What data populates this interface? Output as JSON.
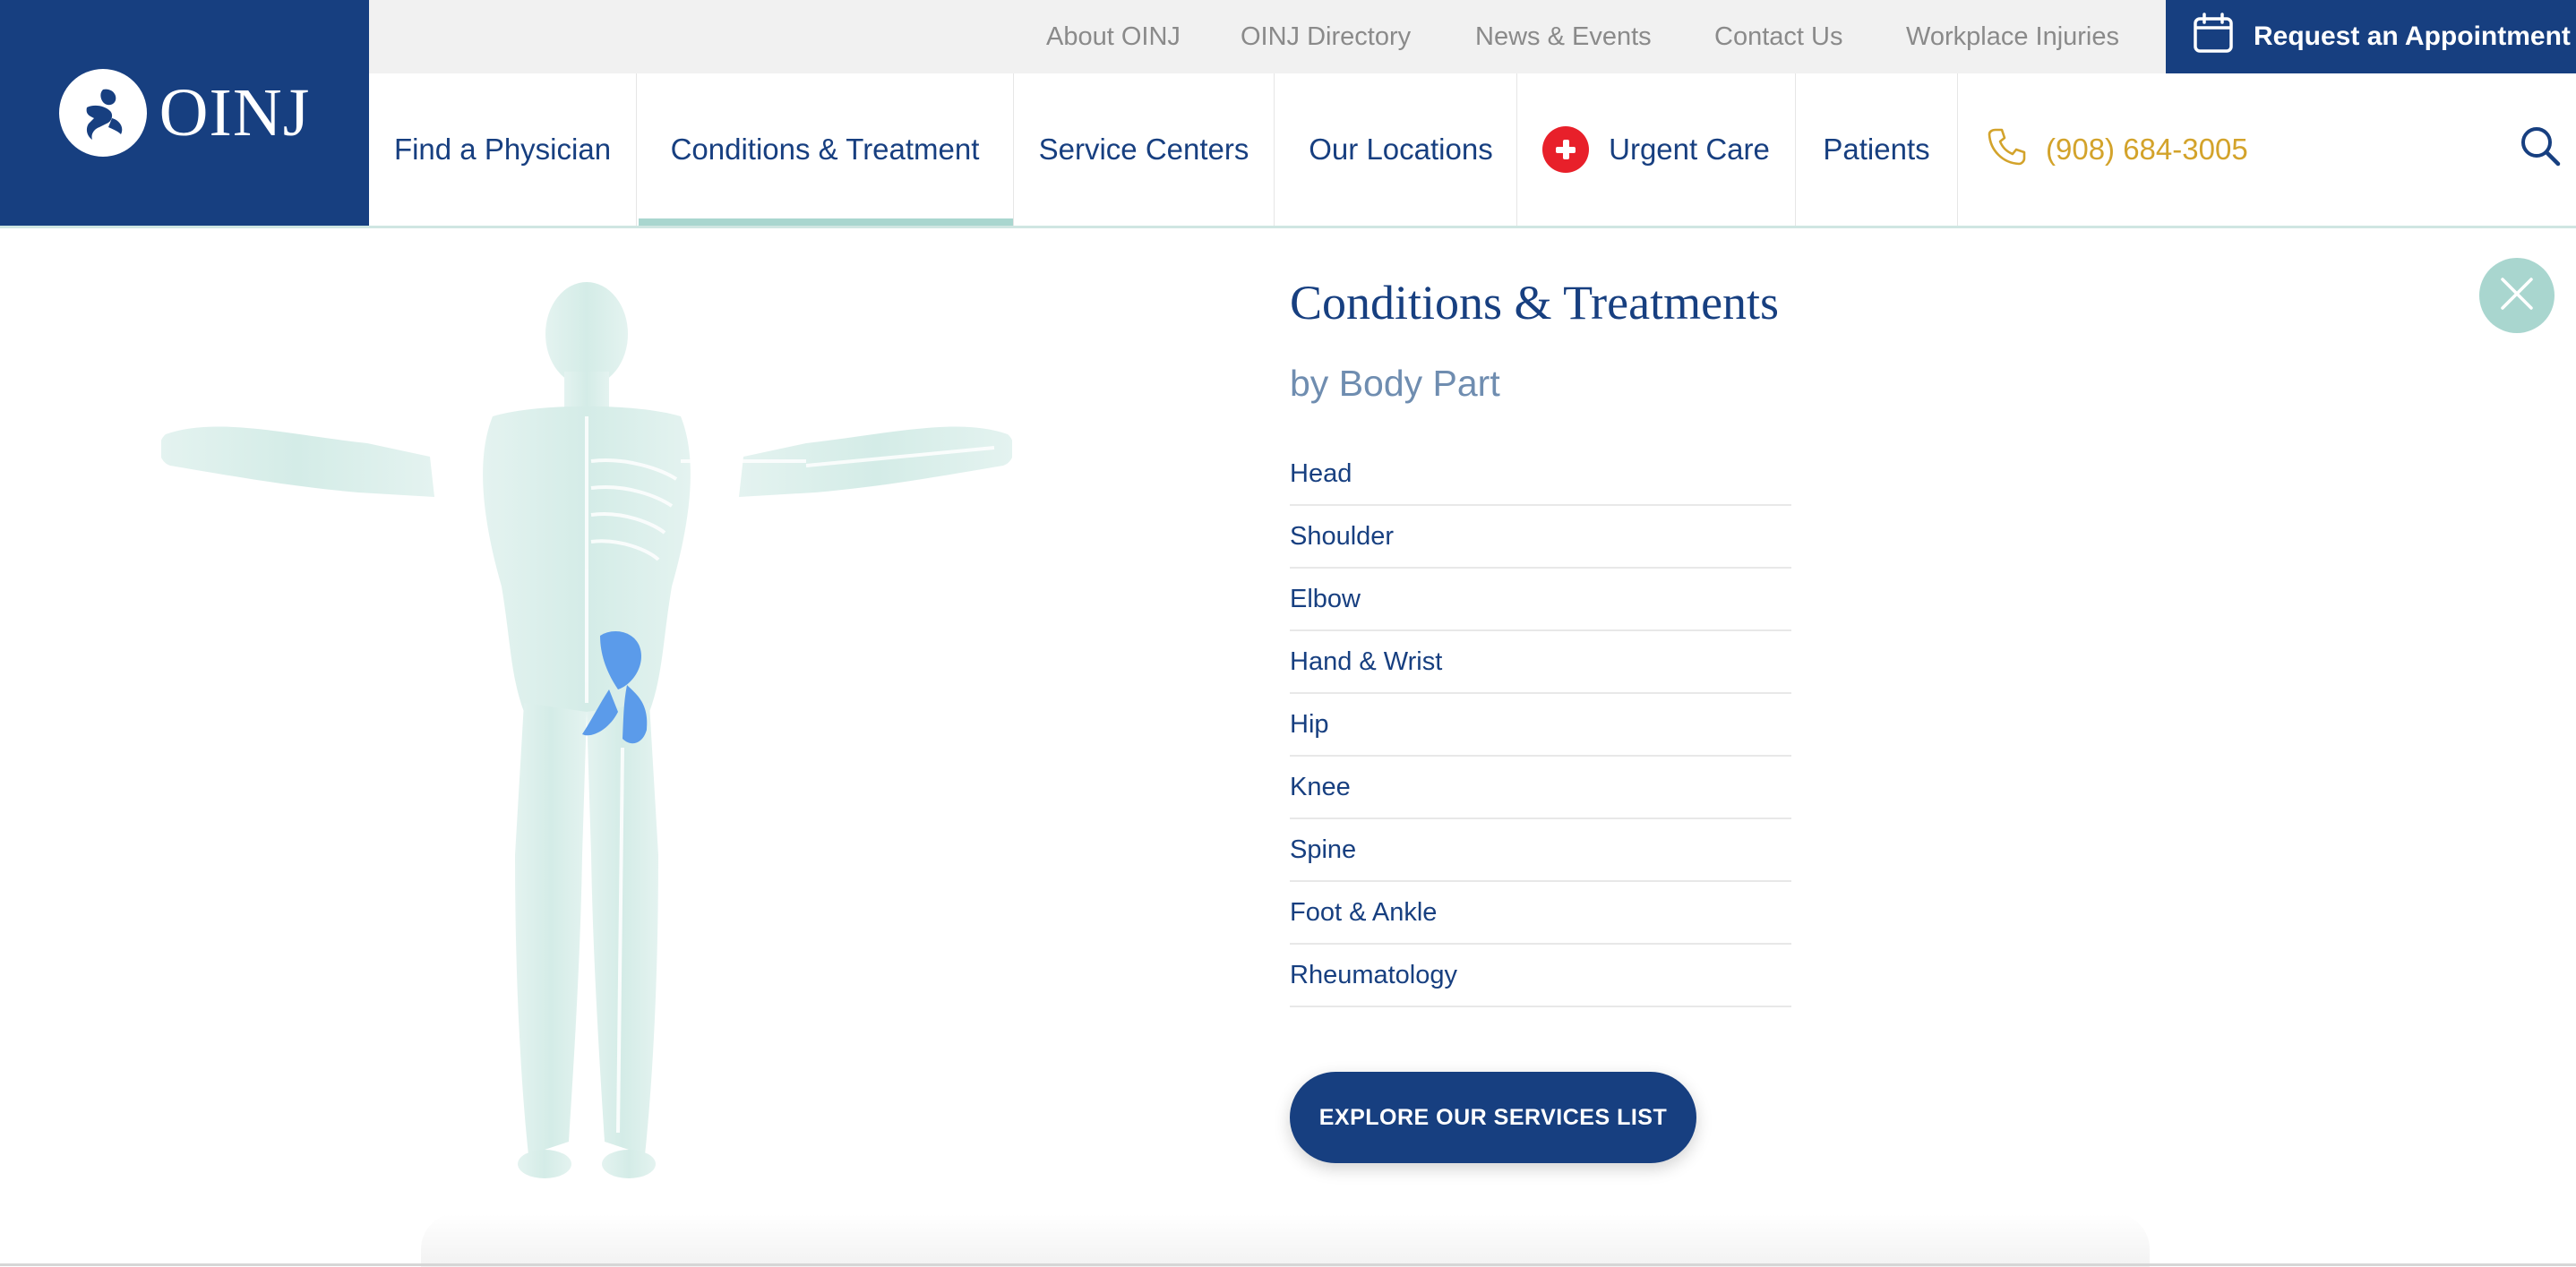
{
  "brand": {
    "name": "OINJ",
    "color": "#173f80",
    "accent": "#a9d6cf",
    "phone_color": "#d3a32b"
  },
  "utility_nav": {
    "links": [
      "About OINJ",
      "OINJ Directory",
      "News & Events",
      "Contact Us",
      "Workplace Injuries"
    ],
    "appointment_label": "Request an Appointment",
    "appointment_icon": "calendar-icon"
  },
  "main_nav": {
    "items": {
      "find_physician": "Find a Physician",
      "conditions": "Conditions & Treatment",
      "service_centers": "Service Centers",
      "locations": "Our Locations",
      "urgent_care": "Urgent Care",
      "patients": "Patients"
    },
    "phone": "(908) 684-3005",
    "active_item": "Conditions & Treatment",
    "search_icon": "search-icon"
  },
  "mega_menu": {
    "title": "Conditions & Treatments",
    "subtitle": "by Body Part",
    "body_parts": [
      "Head",
      "Shoulder",
      "Elbow",
      "Hand & Wrist",
      "Hip",
      "Knee",
      "Spine",
      "Foot & Ankle",
      "Rheumatology"
    ],
    "highlighted_body_part": "Hip",
    "explore_button": "EXPLORE OUR SERVICES LIST",
    "close_icon": "close-icon"
  }
}
